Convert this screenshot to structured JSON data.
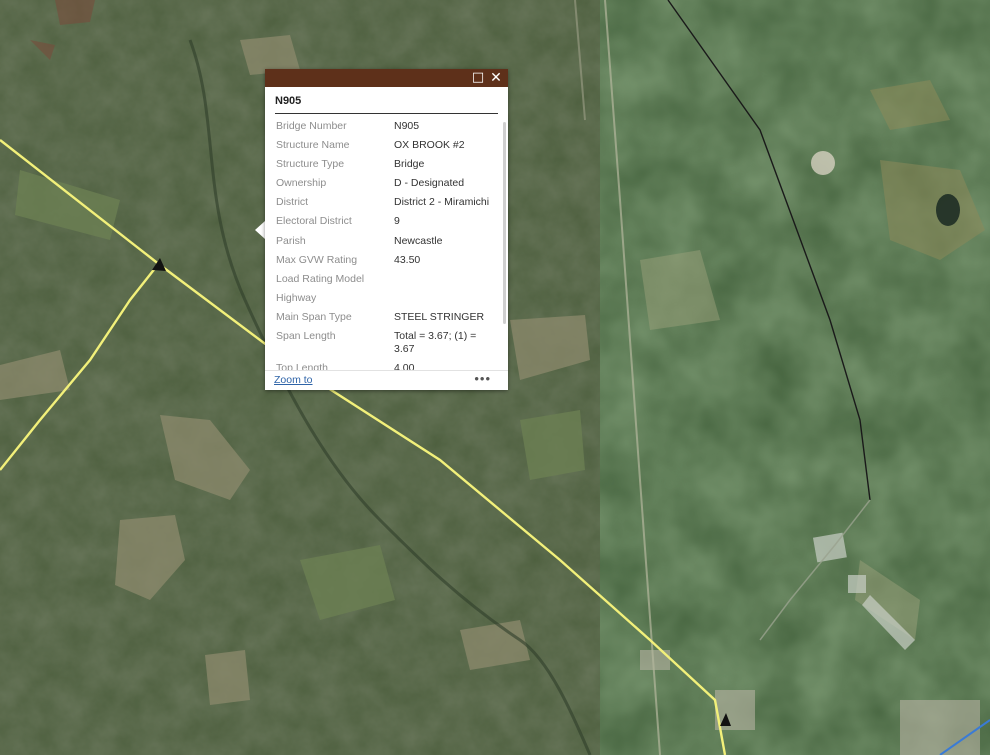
{
  "map": {
    "colors": {
      "imagery_left": "#4d5f3e",
      "imagery_right": "#46643f",
      "road_line": "#f2f07a",
      "road_boundary": "#1a1a1a"
    }
  },
  "popup": {
    "colors": {
      "titlebar": "#5e301a",
      "label": "#8d8d8d",
      "value": "#333333",
      "link": "#2f64a8"
    },
    "maximize_icon": "□",
    "close_icon": "✕",
    "title": "N905",
    "attributes": [
      {
        "label": "Bridge Number",
        "value": "N905"
      },
      {
        "label": "Structure Name",
        "value": "OX BROOK #2"
      },
      {
        "label": "Structure Type",
        "value": "Bridge"
      },
      {
        "label": "Ownership",
        "value": "D - Designated"
      },
      {
        "label": "District",
        "value": "District 2 - Miramichi"
      },
      {
        "label": "Electoral District",
        "value": "9"
      },
      {
        "label": "Parish",
        "value": "Newcastle"
      },
      {
        "label": "Max GVW Rating",
        "value": "43.50"
      },
      {
        "label": "Load Rating Model",
        "value": ""
      },
      {
        "label": "Highway",
        "value": ""
      },
      {
        "label": "Main Span Type",
        "value": "STEEL STRINGER"
      },
      {
        "label": "Span Length",
        "value": "Total = 3.67; (1) = 3.67"
      },
      {
        "label": "Top Length",
        "value": "4.00"
      }
    ],
    "zoom_link": "Zoom to",
    "more_icon": "•••"
  }
}
